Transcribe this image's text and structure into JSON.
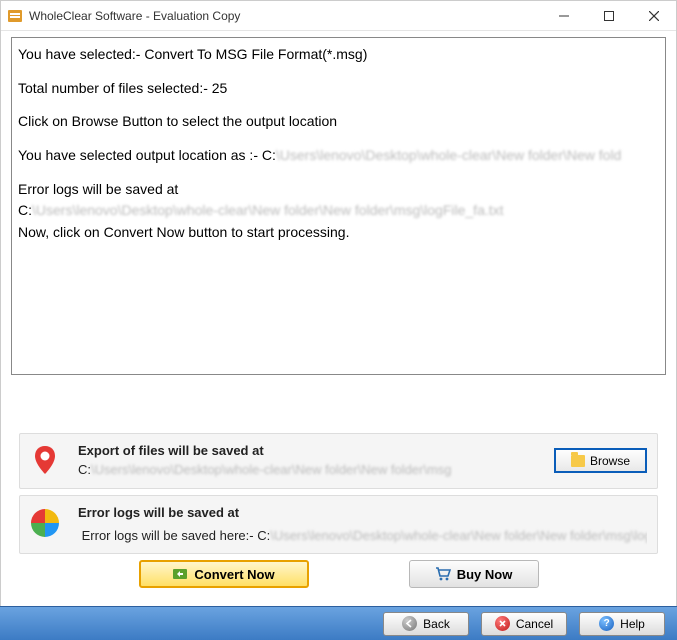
{
  "window": {
    "title": "WholeClear Software - Evaluation Copy"
  },
  "log": {
    "line1": "You have selected:- Convert To MSG File Format(*.msg)",
    "line2": "Total number of files selected:- 25",
    "line3": "Click on Browse Button to select the output location",
    "line4_pre": "You have selected output location as :- ",
    "line4_path_clear": "C:",
    "line4_path_blur": "\\Users\\lenovo\\Desktop\\whole-clear\\New folder\\New fold",
    "line5": "Error logs will be saved at",
    "line6_clear": "C:",
    "line6_blur": "\\Users\\lenovo\\Desktop\\whole-clear\\New folder\\New folder\\msg\\logFile_fa.txt",
    "line7": "Now, click on Convert Now button to start processing."
  },
  "export_row": {
    "label": "Export of files will be saved at",
    "path_clear": "C:",
    "path_blur": "\\Users\\lenovo\\Desktop\\whole-clear\\New folder\\New folder\\msg",
    "browse_label": "Browse"
  },
  "error_row": {
    "label": "Error logs will be saved at",
    "inline_prefix": "Error logs will be saved here:- ",
    "path_clear": "C:",
    "path_blur": "\\Users\\lenovo\\Desktop\\whole-clear\\New folder\\New folder\\msg\\logF"
  },
  "buttons": {
    "convert": "Convert Now",
    "buy": "Buy Now",
    "back": "Back",
    "cancel": "Cancel",
    "help": "Help"
  }
}
